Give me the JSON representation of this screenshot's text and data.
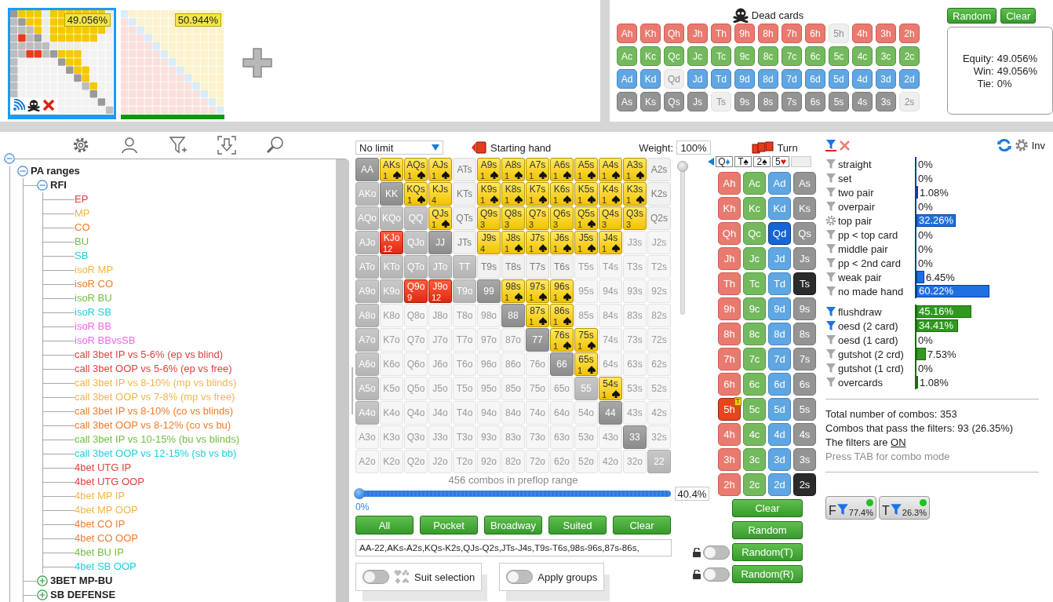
{
  "thumbnails": [
    {
      "equity": "49.056%",
      "selected": true,
      "color": "#1e9bf0"
    },
    {
      "equity": "50.944%",
      "selected": false,
      "color": "#0a9a0a"
    }
  ],
  "dead_cards": {
    "title": "Dead cards",
    "buttons": [
      "Random",
      "Clear"
    ],
    "rows": [
      {
        "kind": "hearts",
        "cards": [
          {
            "label": "Ah",
            "disabled": false
          },
          {
            "label": "Kh",
            "disabled": false
          },
          {
            "label": "Qh",
            "disabled": false
          },
          {
            "label": "Jh",
            "disabled": false
          },
          {
            "label": "Th",
            "disabled": false
          },
          {
            "label": "9h",
            "disabled": false
          },
          {
            "label": "8h",
            "disabled": false
          },
          {
            "label": "7h",
            "disabled": false
          },
          {
            "label": "6h",
            "disabled": false
          },
          {
            "label": "5h",
            "disabled": true
          },
          {
            "label": "4h",
            "disabled": false
          },
          {
            "label": "3h",
            "disabled": false
          },
          {
            "label": "2h",
            "disabled": false
          }
        ]
      },
      {
        "kind": "clubs",
        "cards": [
          {
            "label": "Ac",
            "disabled": false
          },
          {
            "label": "Kc",
            "disabled": false
          },
          {
            "label": "Qc",
            "disabled": false
          },
          {
            "label": "Jc",
            "disabled": false
          },
          {
            "label": "Tc",
            "disabled": false
          },
          {
            "label": "9c",
            "disabled": false
          },
          {
            "label": "8c",
            "disabled": false
          },
          {
            "label": "7c",
            "disabled": false
          },
          {
            "label": "6c",
            "disabled": false
          },
          {
            "label": "5c",
            "disabled": false
          },
          {
            "label": "4c",
            "disabled": false
          },
          {
            "label": "3c",
            "disabled": false
          },
          {
            "label": "2c",
            "disabled": false
          }
        ]
      },
      {
        "kind": "diamonds",
        "cards": [
          {
            "label": "Ad",
            "disabled": false
          },
          {
            "label": "Kd",
            "disabled": false
          },
          {
            "label": "Qd",
            "disabled": true
          },
          {
            "label": "Jd",
            "disabled": false
          },
          {
            "label": "Td",
            "disabled": false
          },
          {
            "label": "9d",
            "disabled": false
          },
          {
            "label": "8d",
            "disabled": false
          },
          {
            "label": "7d",
            "disabled": false
          },
          {
            "label": "6d",
            "disabled": false
          },
          {
            "label": "5d",
            "disabled": false
          },
          {
            "label": "4d",
            "disabled": false
          },
          {
            "label": "3d",
            "disabled": false
          },
          {
            "label": "2d",
            "disabled": false
          }
        ]
      },
      {
        "kind": "spades",
        "cards": [
          {
            "label": "As",
            "disabled": false
          },
          {
            "label": "Ks",
            "disabled": false
          },
          {
            "label": "Qs",
            "disabled": false
          },
          {
            "label": "Js",
            "disabled": false
          },
          {
            "label": "Ts",
            "disabled": true
          },
          {
            "label": "9s",
            "disabled": false
          },
          {
            "label": "8s",
            "disabled": false
          },
          {
            "label": "7s",
            "disabled": false
          },
          {
            "label": "6s",
            "disabled": false
          },
          {
            "label": "5s",
            "disabled": false
          },
          {
            "label": "4s",
            "disabled": false
          },
          {
            "label": "3s",
            "disabled": false
          },
          {
            "label": "2s",
            "disabled": true
          }
        ]
      }
    ],
    "equity_box": [
      {
        "label": "Equity:",
        "value": "49.056%"
      },
      {
        "label": "Win:",
        "value": "49.056%"
      },
      {
        "label": "Tie:",
        "value": "0%"
      }
    ]
  },
  "tree": {
    "root_expanded": true,
    "items": [
      {
        "label": "PA ranges",
        "expanded": true,
        "children": [
          {
            "label": "RFI",
            "expanded": true,
            "children": [
              {
                "label": "EP",
                "color": "#e2403c"
              },
              {
                "label": "MP",
                "color": "#f5b54a"
              },
              {
                "label": "CO",
                "color": "#f47b2a"
              },
              {
                "label": "BU",
                "color": "#72c040"
              },
              {
                "label": "SB",
                "color": "#1fd0e0"
              },
              {
                "label": "isoR MP",
                "color": "#f5b54a"
              },
              {
                "label": "isoR CO",
                "color": "#f47b2a"
              },
              {
                "label": "isoR BU",
                "color": "#72c040"
              },
              {
                "label": "isoR SB",
                "color": "#1fd0e0"
              },
              {
                "label": "isoR BB",
                "color": "#e86ae8"
              },
              {
                "label": "isoR BBvsSB",
                "color": "#e86ae8"
              },
              {
                "label": "call 3bet IP vs 5-6% (ep vs blind)",
                "color": "#e2403c"
              },
              {
                "label": "call 3bet OOP vs 5-6% (ep vs free)",
                "color": "#e2403c"
              },
              {
                "label": "call 3bet IP vs 8-10% (mp vs blinds)",
                "color": "#f5b54a"
              },
              {
                "label": "call 3bet OOP vs 7-8% (mp vs free)",
                "color": "#f5b54a"
              },
              {
                "label": "call 3bet IP vs 8-10% (co vs blinds)",
                "color": "#f47b2a"
              },
              {
                "label": "call 3bet OOP vs 8-12% (co vs bu)",
                "color": "#f47b2a"
              },
              {
                "label": "call 3bet IP vs 10-15% (bu vs blinds)",
                "color": "#72c040"
              },
              {
                "label": "call 3bet OOP vs 12-15% (sb vs bb)",
                "color": "#1fd0e0"
              },
              {
                "label": "4bet UTG IP",
                "color": "#e2403c"
              },
              {
                "label": "4bet UTG OOP",
                "color": "#e2403c"
              },
              {
                "label": "4bet MP IP",
                "color": "#f5b54a"
              },
              {
                "label": "4bet MP OOP",
                "color": "#f5b54a"
              },
              {
                "label": "4bet CO IP",
                "color": "#f47b2a"
              },
              {
                "label": "4bet CO OOP",
                "color": "#f47b2a"
              },
              {
                "label": "4bet BU IP",
                "color": "#72c040"
              },
              {
                "label": "4bet SB OOP",
                "color": "#1fd0e0"
              }
            ]
          },
          {
            "label": "3BET MP-BU",
            "expanded": false
          },
          {
            "label": "SB DEFENSE",
            "expanded": false
          }
        ]
      }
    ]
  },
  "range_panel": {
    "game": "No limit",
    "title": "Starting hand",
    "weight_label": "Weight:",
    "weight": "100%",
    "weight_slider": {
      "level": 1
    },
    "combos_text": "456 combos in preflop range",
    "slider": {
      "level": 1,
      "min_label": "0%",
      "value": "40.4%"
    },
    "buttons": [
      "All",
      "Pocket",
      "Broadway",
      "Suited",
      "Clear"
    ],
    "range_text": "AA-22,AKs-A2s,KQs-K2s,QJs-Q2s,JTs-J4s,T9s-T6s,98s-96s,87s-86s,",
    "toggles": [
      {
        "label": "Suit selection",
        "on": false,
        "kind": "suits"
      },
      {
        "label": "Apply groups",
        "on": false,
        "kind": "plain"
      }
    ]
  },
  "range_grid": {
    "rows": [
      [
        {
          "label": "AA",
          "kind": "dark"
        },
        {
          "label": "AKs",
          "kind": "hit",
          "count": "1",
          "flush": true
        },
        {
          "label": "AQs",
          "kind": "hit",
          "count": "1",
          "flush": true
        },
        {
          "label": "AJs",
          "kind": "hit",
          "count": "1",
          "flush": true
        },
        {
          "label": "ATs",
          "kind": "dim"
        },
        {
          "label": "A9s",
          "kind": "hit",
          "count": "1",
          "flush": true
        },
        {
          "label": "A8s",
          "kind": "hit",
          "count": "1",
          "flush": true
        },
        {
          "label": "A7s",
          "kind": "hit",
          "count": "1",
          "flush": true
        },
        {
          "label": "A6s",
          "kind": "hit",
          "count": "1",
          "flush": true
        },
        {
          "label": "A5s",
          "kind": "hit",
          "count": "1",
          "flush": true
        },
        {
          "label": "A4s",
          "kind": "hit",
          "count": "1",
          "flush": true
        },
        {
          "label": "A3s",
          "kind": "hit",
          "count": "1",
          "flush": true
        },
        {
          "label": "A2s",
          "kind": "dim"
        }
      ],
      [
        {
          "label": "AKo",
          "kind": "mid"
        },
        {
          "label": "KK",
          "kind": "dark"
        },
        {
          "label": "KQs",
          "kind": "hit",
          "count": "1",
          "flush": true
        },
        {
          "label": "KJs",
          "kind": "hit",
          "count": "4",
          "flush": false
        },
        {
          "label": "KTs",
          "kind": "dim"
        },
        {
          "label": "K9s",
          "kind": "hit",
          "count": "1",
          "flush": true
        },
        {
          "label": "K8s",
          "kind": "hit",
          "count": "1",
          "flush": true
        },
        {
          "label": "K7s",
          "kind": "hit",
          "count": "1",
          "flush": true
        },
        {
          "label": "K6s",
          "kind": "hit",
          "count": "1",
          "flush": true
        },
        {
          "label": "K5s",
          "kind": "hit",
          "count": "1",
          "flush": true
        },
        {
          "label": "K4s",
          "kind": "hit",
          "count": "1",
          "flush": true
        },
        {
          "label": "K3s",
          "kind": "hit",
          "count": "1",
          "flush": true
        },
        {
          "label": "K2s",
          "kind": "dim"
        }
      ],
      [
        {
          "label": "AQo",
          "kind": "mid"
        },
        {
          "label": "KQo",
          "kind": "mid"
        },
        {
          "label": "QQ",
          "kind": "mid"
        },
        {
          "label": "QJs",
          "kind": "hit",
          "count": "1",
          "flush": true
        },
        {
          "label": "QTs",
          "kind": "dim"
        },
        {
          "label": "Q9s",
          "kind": "hit",
          "count": "3",
          "flush": false
        },
        {
          "label": "Q8s",
          "kind": "hit",
          "count": "3",
          "flush": false
        },
        {
          "label": "Q7s",
          "kind": "hit",
          "count": "3",
          "flush": false
        },
        {
          "label": "Q6s",
          "kind": "hit",
          "count": "3",
          "flush": false
        },
        {
          "label": "Q5s",
          "kind": "hit",
          "count": "1",
          "flush": true
        },
        {
          "label": "Q4s",
          "kind": "hit",
          "count": "3",
          "flush": false
        },
        {
          "label": "Q3s",
          "kind": "hit",
          "count": "3",
          "flush": false
        },
        {
          "label": "Q2s",
          "kind": "dim"
        }
      ],
      [
        {
          "label": "AJo",
          "kind": "mid"
        },
        {
          "label": "KJo",
          "kind": "red",
          "count": "12",
          "flush": false
        },
        {
          "label": "QJo",
          "kind": "mid"
        },
        {
          "label": "JJ",
          "kind": "dark"
        },
        {
          "label": "JTs",
          "kind": "dim"
        },
        {
          "label": "J9s",
          "kind": "hit",
          "count": "4",
          "flush": false
        },
        {
          "label": "J8s",
          "kind": "hit",
          "count": "1",
          "flush": true
        },
        {
          "label": "J7s",
          "kind": "hit",
          "count": "1",
          "flush": true
        },
        {
          "label": "J6s",
          "kind": "hit",
          "count": "1",
          "flush": true
        },
        {
          "label": "J5s",
          "kind": "hit",
          "count": "1",
          "flush": true
        },
        {
          "label": "J4s",
          "kind": "hit",
          "count": "1",
          "flush": true
        },
        {
          "label": "J3s",
          "kind": "off"
        },
        {
          "label": "J2s",
          "kind": "off"
        }
      ],
      [
        {
          "label": "ATo",
          "kind": "mid"
        },
        {
          "label": "KTo",
          "kind": "mid"
        },
        {
          "label": "QTo",
          "kind": "mid"
        },
        {
          "label": "JTo",
          "kind": "mid"
        },
        {
          "label": "TT",
          "kind": "mid"
        },
        {
          "label": "T9s",
          "kind": "dim"
        },
        {
          "label": "T8s",
          "kind": "dim"
        },
        {
          "label": "T7s",
          "kind": "dim"
        },
        {
          "label": "T6s",
          "kind": "dim"
        },
        {
          "label": "T5s",
          "kind": "off"
        },
        {
          "label": "T4s",
          "kind": "off"
        },
        {
          "label": "T3s",
          "kind": "off"
        },
        {
          "label": "T2s",
          "kind": "off"
        }
      ],
      [
        {
          "label": "A9o",
          "kind": "mid"
        },
        {
          "label": "K9o",
          "kind": "mid"
        },
        {
          "label": "Q9o",
          "kind": "red",
          "count": "9",
          "flush": false
        },
        {
          "label": "J9o",
          "kind": "red",
          "count": "12",
          "flush": false
        },
        {
          "label": "T9o",
          "kind": "mid"
        },
        {
          "label": "99",
          "kind": "dark"
        },
        {
          "label": "98s",
          "kind": "hit",
          "count": "1",
          "flush": true
        },
        {
          "label": "97s",
          "kind": "hit",
          "count": "1",
          "flush": true
        },
        {
          "label": "96s",
          "kind": "hit",
          "count": "1",
          "flush": true
        },
        {
          "label": "95s",
          "kind": "off"
        },
        {
          "label": "94s",
          "kind": "off"
        },
        {
          "label": "93s",
          "kind": "off"
        },
        {
          "label": "92s",
          "kind": "off"
        }
      ],
      [
        {
          "label": "A8o",
          "kind": "mid"
        },
        {
          "label": "K8o",
          "kind": "off"
        },
        {
          "label": "Q8o",
          "kind": "off"
        },
        {
          "label": "J8o",
          "kind": "off"
        },
        {
          "label": "T8o",
          "kind": "off"
        },
        {
          "label": "98o",
          "kind": "off"
        },
        {
          "label": "88",
          "kind": "dark"
        },
        {
          "label": "87s",
          "kind": "hit",
          "count": "1",
          "flush": true
        },
        {
          "label": "86s",
          "kind": "hit",
          "count": "1",
          "flush": true
        },
        {
          "label": "85s",
          "kind": "off"
        },
        {
          "label": "84s",
          "kind": "off"
        },
        {
          "label": "83s",
          "kind": "off"
        },
        {
          "label": "82s",
          "kind": "off"
        }
      ],
      [
        {
          "label": "A7o",
          "kind": "mid"
        },
        {
          "label": "K7o",
          "kind": "off"
        },
        {
          "label": "Q7o",
          "kind": "off"
        },
        {
          "label": "J7o",
          "kind": "off"
        },
        {
          "label": "T7o",
          "kind": "off"
        },
        {
          "label": "97o",
          "kind": "off"
        },
        {
          "label": "87o",
          "kind": "off"
        },
        {
          "label": "77",
          "kind": "dark"
        },
        {
          "label": "76s",
          "kind": "hit",
          "count": "1",
          "flush": true
        },
        {
          "label": "75s",
          "kind": "hit",
          "count": "1",
          "flush": true
        },
        {
          "label": "74s",
          "kind": "off"
        },
        {
          "label": "73s",
          "kind": "off"
        },
        {
          "label": "72s",
          "kind": "off"
        }
      ],
      [
        {
          "label": "A6o",
          "kind": "mid"
        },
        {
          "label": "K6o",
          "kind": "off"
        },
        {
          "label": "Q6o",
          "kind": "off"
        },
        {
          "label": "J6o",
          "kind": "off"
        },
        {
          "label": "T6o",
          "kind": "off"
        },
        {
          "label": "96o",
          "kind": "off"
        },
        {
          "label": "86o",
          "kind": "off"
        },
        {
          "label": "76o",
          "kind": "off"
        },
        {
          "label": "66",
          "kind": "dark"
        },
        {
          "label": "65s",
          "kind": "hit",
          "count": "1",
          "flush": true
        },
        {
          "label": "64s",
          "kind": "off"
        },
        {
          "label": "63s",
          "kind": "off"
        },
        {
          "label": "62s",
          "kind": "off"
        }
      ],
      [
        {
          "label": "A5o",
          "kind": "mid"
        },
        {
          "label": "K5o",
          "kind": "off"
        },
        {
          "label": "Q5o",
          "kind": "off"
        },
        {
          "label": "J5o",
          "kind": "off"
        },
        {
          "label": "T5o",
          "kind": "off"
        },
        {
          "label": "95o",
          "kind": "off"
        },
        {
          "label": "85o",
          "kind": "off"
        },
        {
          "label": "75o",
          "kind": "off"
        },
        {
          "label": "65o",
          "kind": "off"
        },
        {
          "label": "55",
          "kind": "mid"
        },
        {
          "label": "54s",
          "kind": "hit",
          "count": "1",
          "flush": true
        },
        {
          "label": "53s",
          "kind": "off"
        },
        {
          "label": "52s",
          "kind": "off"
        }
      ],
      [
        {
          "label": "A4o",
          "kind": "mid"
        },
        {
          "label": "K4o",
          "kind": "off"
        },
        {
          "label": "Q4o",
          "kind": "off"
        },
        {
          "label": "J4o",
          "kind": "off"
        },
        {
          "label": "T4o",
          "kind": "off"
        },
        {
          "label": "94o",
          "kind": "off"
        },
        {
          "label": "84o",
          "kind": "off"
        },
        {
          "label": "74o",
          "kind": "off"
        },
        {
          "label": "64o",
          "kind": "off"
        },
        {
          "label": "54o",
          "kind": "off"
        },
        {
          "label": "44",
          "kind": "dark"
        },
        {
          "label": "43s",
          "kind": "off"
        },
        {
          "label": "42s",
          "kind": "off"
        }
      ],
      [
        {
          "label": "A3o",
          "kind": "off"
        },
        {
          "label": "K3o",
          "kind": "off"
        },
        {
          "label": "Q3o",
          "kind": "off"
        },
        {
          "label": "J3o",
          "kind": "off"
        },
        {
          "label": "T3o",
          "kind": "off"
        },
        {
          "label": "93o",
          "kind": "off"
        },
        {
          "label": "83o",
          "kind": "off"
        },
        {
          "label": "73o",
          "kind": "off"
        },
        {
          "label": "63o",
          "kind": "off"
        },
        {
          "label": "53o",
          "kind": "off"
        },
        {
          "label": "43o",
          "kind": "off"
        },
        {
          "label": "33",
          "kind": "dark"
        },
        {
          "label": "32s",
          "kind": "off"
        }
      ],
      [
        {
          "label": "A2o",
          "kind": "off"
        },
        {
          "label": "K2o",
          "kind": "off"
        },
        {
          "label": "Q2o",
          "kind": "off"
        },
        {
          "label": "J2o",
          "kind": "off"
        },
        {
          "label": "T2o",
          "kind": "off"
        },
        {
          "label": "92o",
          "kind": "off"
        },
        {
          "label": "82o",
          "kind": "off"
        },
        {
          "label": "72o",
          "kind": "off"
        },
        {
          "label": "62o",
          "kind": "off"
        },
        {
          "label": "52o",
          "kind": "off"
        },
        {
          "label": "42o",
          "kind": "off"
        },
        {
          "label": "32o",
          "kind": "off"
        },
        {
          "label": "22",
          "kind": "mid"
        }
      ]
    ]
  },
  "board": {
    "street": "Turn",
    "cards": [
      {
        "rank": "Q",
        "symbol": "♦",
        "kind": "diamonds"
      },
      {
        "rank": "T",
        "symbol": "♠",
        "kind": "spades"
      },
      {
        "rank": "2",
        "symbol": "♠",
        "kind": "spades"
      },
      {
        "rank": "5",
        "symbol": "♥",
        "kind": "hearts"
      }
    ],
    "rows": [
      [
        {
          "label": "Ah",
          "kind": "hearts",
          "selected": false
        },
        {
          "label": "Ac",
          "kind": "clubs",
          "selected": false
        },
        {
          "label": "Ad",
          "kind": "diamonds",
          "selected": false
        },
        {
          "label": "As",
          "kind": "spades",
          "selected": false
        }
      ],
      [
        {
          "label": "Kh",
          "kind": "hearts",
          "selected": false
        },
        {
          "label": "Kc",
          "kind": "clubs",
          "selected": false
        },
        {
          "label": "Kd",
          "kind": "diamonds",
          "selected": false
        },
        {
          "label": "Ks",
          "kind": "spades",
          "selected": false
        }
      ],
      [
        {
          "label": "Qh",
          "kind": "hearts",
          "selected": false
        },
        {
          "label": "Qc",
          "kind": "clubs",
          "selected": false
        },
        {
          "label": "Qd",
          "kind": "diamonds",
          "selected": true
        },
        {
          "label": "Qs",
          "kind": "spades",
          "selected": false
        }
      ],
      [
        {
          "label": "Jh",
          "kind": "hearts",
          "selected": false
        },
        {
          "label": "Jc",
          "kind": "clubs",
          "selected": false
        },
        {
          "label": "Jd",
          "kind": "diamonds",
          "selected": false
        },
        {
          "label": "Js",
          "kind": "spades",
          "selected": false
        }
      ],
      [
        {
          "label": "Th",
          "kind": "hearts",
          "selected": false
        },
        {
          "label": "Tc",
          "kind": "clubs",
          "selected": false
        },
        {
          "label": "Td",
          "kind": "diamonds",
          "selected": false
        },
        {
          "label": "Ts",
          "kind": "spades",
          "selected": true
        }
      ],
      [
        {
          "label": "9h",
          "kind": "hearts",
          "selected": false
        },
        {
          "label": "9c",
          "kind": "clubs",
          "selected": false
        },
        {
          "label": "9d",
          "kind": "diamonds",
          "selected": false
        },
        {
          "label": "9s",
          "kind": "spades",
          "selected": false
        }
      ],
      [
        {
          "label": "8h",
          "kind": "hearts",
          "selected": false
        },
        {
          "label": "8c",
          "kind": "clubs",
          "selected": false
        },
        {
          "label": "8d",
          "kind": "diamonds",
          "selected": false
        },
        {
          "label": "8s",
          "kind": "spades",
          "selected": false
        }
      ],
      [
        {
          "label": "7h",
          "kind": "hearts",
          "selected": false
        },
        {
          "label": "7c",
          "kind": "clubs",
          "selected": false
        },
        {
          "label": "7d",
          "kind": "diamonds",
          "selected": false
        },
        {
          "label": "7s",
          "kind": "spades",
          "selected": false
        }
      ],
      [
        {
          "label": "6h",
          "kind": "hearts",
          "selected": false
        },
        {
          "label": "6c",
          "kind": "clubs",
          "selected": false
        },
        {
          "label": "6d",
          "kind": "diamonds",
          "selected": false
        },
        {
          "label": "6s",
          "kind": "spades",
          "selected": false
        }
      ],
      [
        {
          "label": "5h",
          "kind": "hearts",
          "selected": true,
          "badge": "T"
        },
        {
          "label": "5c",
          "kind": "clubs",
          "selected": false
        },
        {
          "label": "5d",
          "kind": "diamonds",
          "selected": false
        },
        {
          "label": "5s",
          "kind": "spades",
          "selected": false
        }
      ],
      [
        {
          "label": "4h",
          "kind": "hearts",
          "selected": false
        },
        {
          "label": "4c",
          "kind": "clubs",
          "selected": false
        },
        {
          "label": "4d",
          "kind": "diamonds",
          "selected": false
        },
        {
          "label": "4s",
          "kind": "spades",
          "selected": false
        }
      ],
      [
        {
          "label": "3h",
          "kind": "hearts",
          "selected": false
        },
        {
          "label": "3c",
          "kind": "clubs",
          "selected": false
        },
        {
          "label": "3d",
          "kind": "diamonds",
          "selected": false
        },
        {
          "label": "3s",
          "kind": "spades",
          "selected": false
        }
      ],
      [
        {
          "label": "2h",
          "kind": "hearts",
          "selected": false
        },
        {
          "label": "2c",
          "kind": "clubs",
          "selected": false
        },
        {
          "label": "2d",
          "kind": "diamonds",
          "selected": false
        },
        {
          "label": "2s",
          "kind": "spades",
          "selected": true
        }
      ]
    ],
    "buttons": [
      {
        "label": "Clear",
        "kind": "plain"
      },
      {
        "label": "Random",
        "kind": "plain"
      },
      {
        "label": "Random(T)",
        "kind": "lock",
        "on": false
      },
      {
        "label": "Random(R)",
        "kind": "lock",
        "on": false
      }
    ]
  },
  "filters": {
    "inv": "Inv",
    "groups": [
      {
        "kind": "made",
        "items": [
          {
            "label": "straight",
            "value": "0%",
            "level": 0,
            "active": false,
            "kind": "funnel"
          },
          {
            "label": "set",
            "value": "0%",
            "level": 0,
            "active": false,
            "kind": "funnel"
          },
          {
            "label": "two pair",
            "value": "1.08%",
            "level": 0.0108,
            "active": false,
            "kind": "funnel"
          },
          {
            "label": "overpair",
            "value": "0%",
            "level": 0,
            "active": false,
            "kind": "funnel"
          },
          {
            "label": "top pair",
            "value": "32.26%",
            "level": 0.3226,
            "active": false,
            "kind": "gear"
          },
          {
            "label": "pp < top card",
            "value": "0%",
            "level": 0,
            "active": false,
            "kind": "funnel"
          },
          {
            "label": "middle pair",
            "value": "0%",
            "level": 0,
            "active": false,
            "kind": "funnel"
          },
          {
            "label": "pp < 2nd card",
            "value": "0%",
            "level": 0,
            "active": false,
            "kind": "funnel"
          },
          {
            "label": "weak pair",
            "value": "6.45%",
            "level": 0.0645,
            "active": false,
            "kind": "funnel"
          },
          {
            "label": "no made hand",
            "value": "60.22%",
            "level": 0.6022,
            "active": false,
            "kind": "funnel"
          }
        ]
      },
      {
        "kind": "draw",
        "items": [
          {
            "label": "flushdraw",
            "value": "45.16%",
            "level": 0.4516,
            "active": true,
            "kind": "funnel"
          },
          {
            "label": "oesd (2 card)",
            "value": "34.41%",
            "level": 0.3441,
            "active": true,
            "kind": "funnel"
          },
          {
            "label": "oesd (1 card)",
            "value": "0%",
            "level": 0,
            "active": false,
            "kind": "funnel"
          },
          {
            "label": "gutshot (2 crd)",
            "value": "7.53%",
            "level": 0.0753,
            "active": false,
            "kind": "funnel"
          },
          {
            "label": "gutshot (1 crd)",
            "value": "0%",
            "level": 0,
            "active": false,
            "kind": "funnel"
          },
          {
            "label": "overcards",
            "value": "1.08%",
            "level": 0.0108,
            "active": false,
            "kind": "funnel"
          }
        ]
      }
    ],
    "stats": [
      "Total number of combos: 353",
      "Combos that pass the filters: 93 (26.35%)"
    ],
    "status": {
      "text": "The filters are",
      "link": "ON"
    },
    "hint": "Press TAB for combo mode",
    "badges": [
      {
        "letter": "F",
        "value": "77.4%",
        "on": true
      },
      {
        "letter": "T",
        "value": "26.3%",
        "on": true
      }
    ]
  }
}
